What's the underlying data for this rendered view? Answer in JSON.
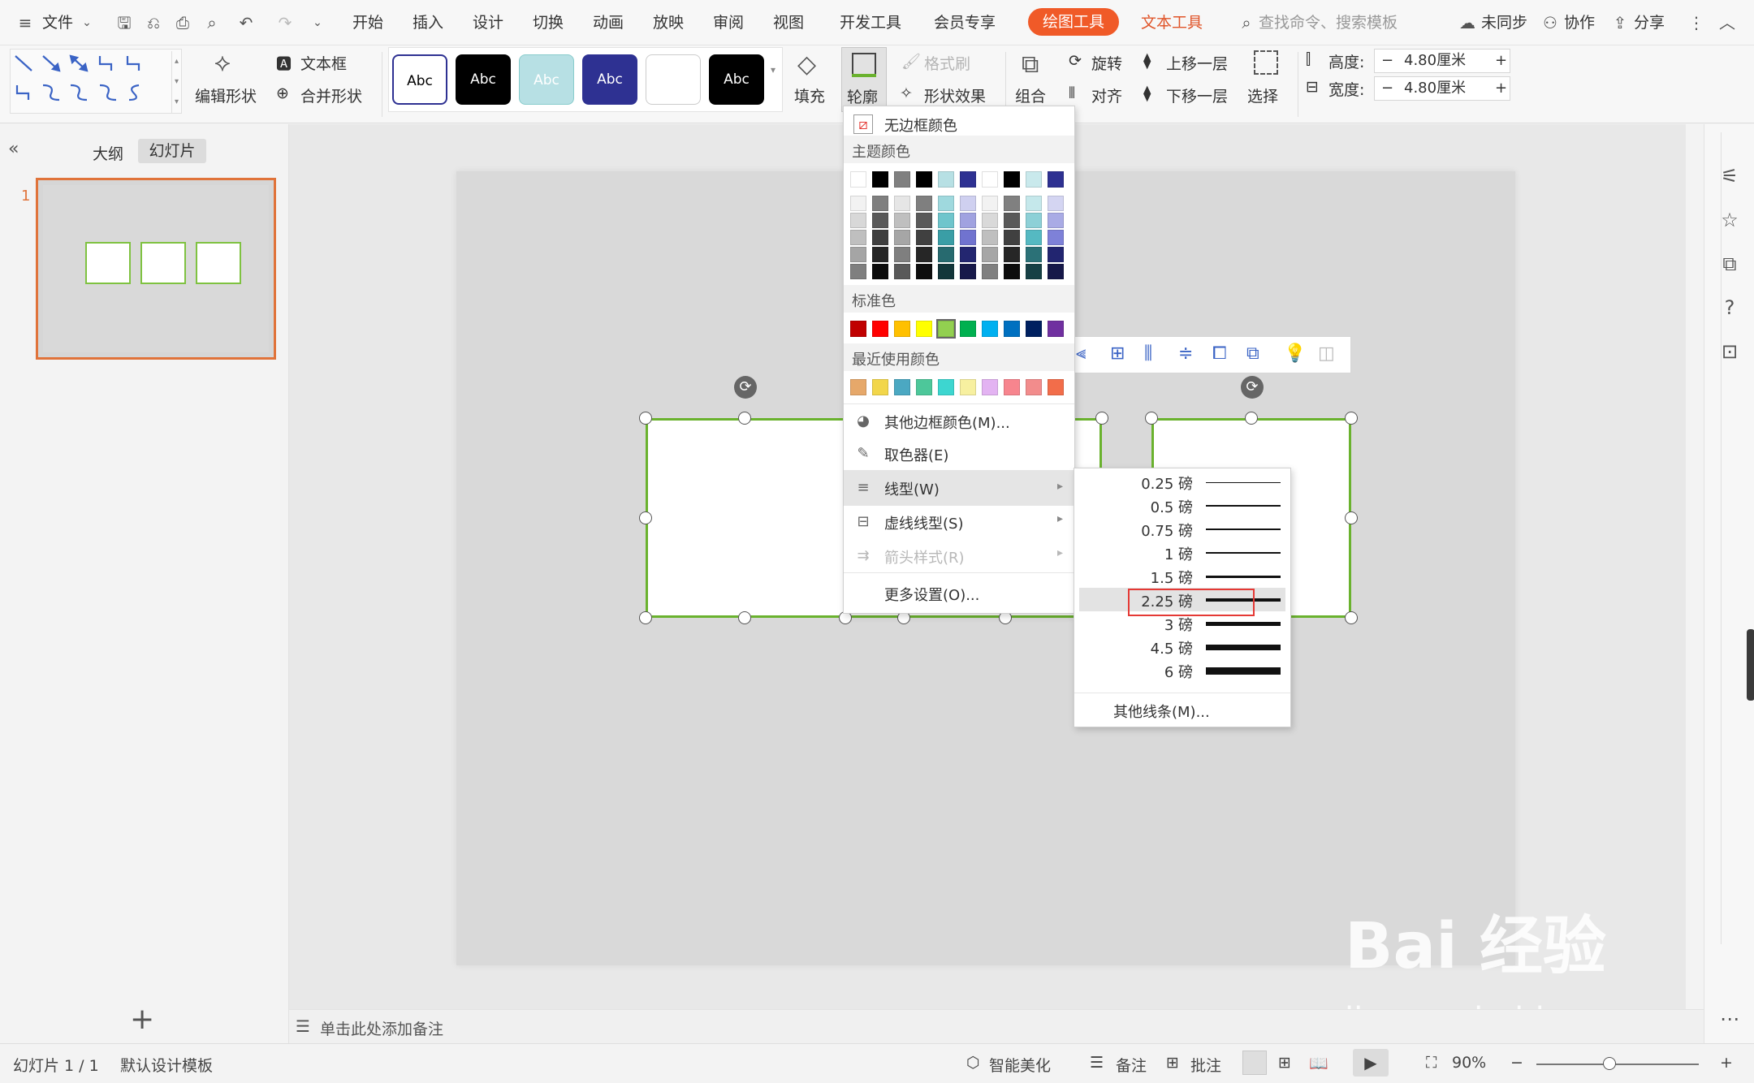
{
  "menubar": {
    "file": "文件",
    "tabs": [
      "开始",
      "插入",
      "设计",
      "切换",
      "动画",
      "放映",
      "审阅",
      "视图",
      "开发工具",
      "会员专享"
    ],
    "draw_tools": "绘图工具",
    "text_tools": "文本工具",
    "search_placeholder": "查找命令、搜索模板",
    "sync": "未同步",
    "collab": "协作",
    "share": "分享"
  },
  "ribbon": {
    "edit_shape": "编辑形状",
    "text_box": "文本框",
    "merge_shape": "合并形状",
    "style_label": "Abc",
    "fill": "填充",
    "outline": "轮廓",
    "format_painter": "格式刷",
    "shape_effects": "形状效果",
    "group": "组合",
    "rotate": "旋转",
    "align": "对齐",
    "bring_forward": "上移一层",
    "send_backward": "下移一层",
    "select": "选择",
    "height_label": "高度:",
    "height_value": "4.80厘米",
    "width_label": "宽度:",
    "width_value": "4.80厘米",
    "minus": "−",
    "plus": "+"
  },
  "left_panel": {
    "tab_outline": "大纲",
    "tab_slides": "幻灯片",
    "slide_number": "1",
    "add": "+"
  },
  "notes": {
    "placeholder": "单击此处添加备注"
  },
  "status": {
    "slide_info": "幻灯片 1 / 1",
    "template": "默认设计模板",
    "beautify": "智能美化",
    "notes": "备注",
    "comment": "批注",
    "zoom": "90%"
  },
  "dropdown": {
    "no_border": "无边框颜色",
    "theme_colors": "主题颜色",
    "standard_colors": "标准色",
    "recent_colors": "最近使用颜色",
    "more_colors": "其他边框颜色(M)...",
    "eyedropper": "取色器(E)",
    "line_type": "线型(W)",
    "dash_type": "虚线线型(S)",
    "arrow_style": "箭头样式(R)",
    "more_settings": "更多设置(O)...",
    "theme_top": [
      "#ffffff",
      "#000000",
      "#808080",
      "#000000",
      "#b7e0e4",
      "#2e3192",
      "#ffffff",
      "#000000",
      "#c9e9ec",
      "#2e3192"
    ],
    "theme_cols": [
      [
        "#f2f2f2",
        "#d8d8d8",
        "#bfbfbf",
        "#a5a5a5",
        "#7f7f7f"
      ],
      [
        "#7f7f7f",
        "#595959",
        "#3f3f3f",
        "#262626",
        "#0c0c0c"
      ],
      [
        "#e6e6e6",
        "#bfbfbf",
        "#a6a6a6",
        "#7f7f7f",
        "#595959"
      ],
      [
        "#7f7f7f",
        "#595959",
        "#404040",
        "#262626",
        "#0d0d0d"
      ],
      [
        "#9fd9de",
        "#6fc5cc",
        "#3a9ea6",
        "#276a6f",
        "#13363a"
      ],
      [
        "#cfd0f0",
        "#a0a2e0",
        "#7073cf",
        "#232670",
        "#17194a"
      ],
      [
        "#f2f2f2",
        "#d9d9d9",
        "#bfbfbf",
        "#a6a6a6",
        "#808080"
      ],
      [
        "#808080",
        "#595959",
        "#404040",
        "#262626",
        "#0d0d0d"
      ],
      [
        "#c5e8eb",
        "#8dd0d7",
        "#55b9c2",
        "#2b7177",
        "#164045"
      ],
      [
        "#d4d5f2",
        "#a9abe5",
        "#7e81d8",
        "#222570",
        "#161849"
      ]
    ],
    "standard": [
      "#c00000",
      "#ff0000",
      "#ffc000",
      "#ffff00",
      "#92d050",
      "#00b050",
      "#00b0f0",
      "#0070c0",
      "#002060",
      "#7030a0"
    ],
    "recent": [
      "#e6a86a",
      "#f2d64a",
      "#4ba8c2",
      "#4dc79a",
      "#3dd6d0",
      "#f7f0a0",
      "#e3b3f2",
      "#f7858e",
      "#f28c8c",
      "#f26d4a"
    ]
  },
  "submenu": {
    "weights": [
      "0.25 磅",
      "0.5 磅",
      "0.75 磅",
      "1 磅",
      "1.5 磅",
      "2.25 磅",
      "3 磅",
      "4.5 磅",
      "6 磅"
    ],
    "selected": "2.25 磅",
    "more_lines": "其他线条(M)..."
  },
  "watermark": {
    "brand": "Bai 经验",
    "url": "jingyan.baidu.com"
  },
  "colors": {
    "accent": "#f05a28",
    "shape_border": "#6ab22e",
    "highlight_box": "#e53935"
  }
}
